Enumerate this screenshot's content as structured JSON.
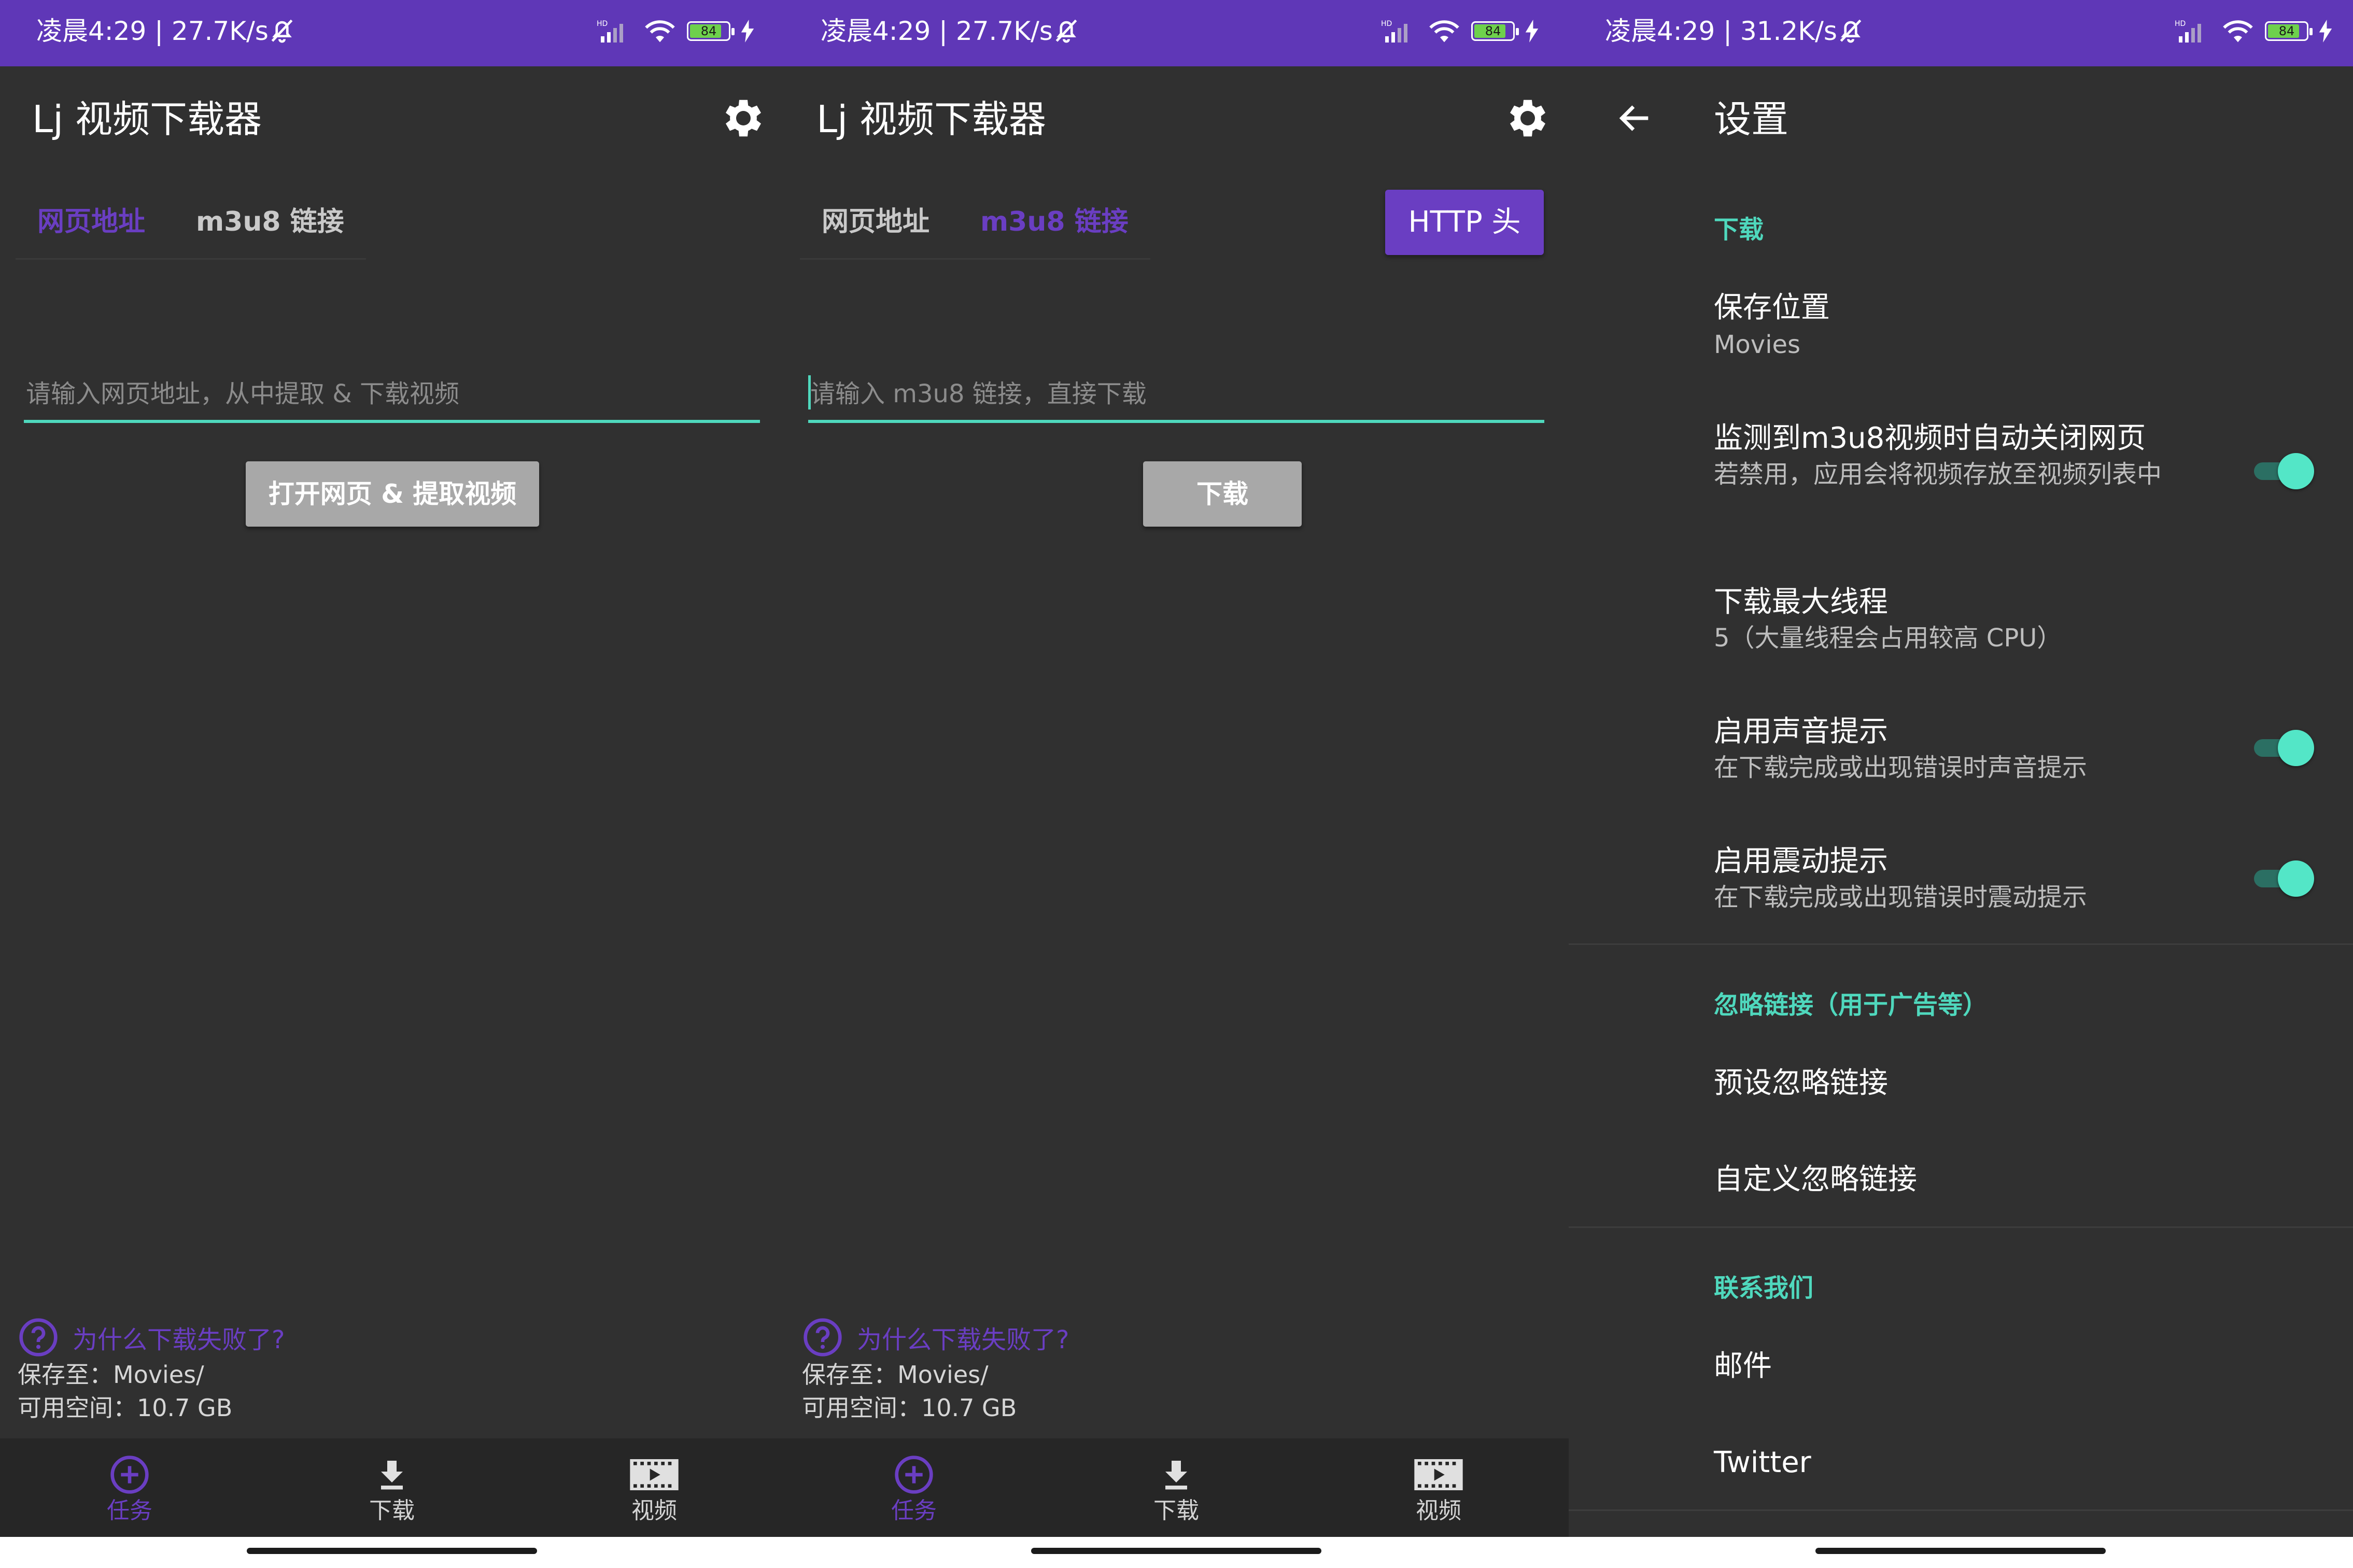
{
  "status_bars": [
    {
      "time_speed": "凌晨4:29 | 27.7K/s",
      "battery": "84"
    },
    {
      "time_speed": "凌晨4:29 | 27.7K/s",
      "battery": "84"
    },
    {
      "time_speed": "凌晨4:29 | 31.2K/s",
      "battery": "84"
    }
  ],
  "app": {
    "title": "Lj 视频下载器"
  },
  "tabs": {
    "webpage": "网页地址",
    "m3u8": "m3u8 链接"
  },
  "screen1": {
    "input_placeholder": "请输入网页地址，从中提取 & 下载视频",
    "button": "打开网页 & 提取视频"
  },
  "screen2": {
    "http_button": "HTTP 头",
    "input_placeholder": "请输入 m3u8 链接，直接下载",
    "button": "下载"
  },
  "footer": {
    "help": "为什么下载失败了?",
    "save_to": "保存至：Movies/",
    "free_space": "可用空间：10.7 GB"
  },
  "nav": {
    "tasks": "任务",
    "downloads": "下载",
    "videos": "视频"
  },
  "settings": {
    "title": "设置",
    "section_download": "下载",
    "save_location_title": "保存位置",
    "save_location_value": "Movies",
    "auto_close_title": "监测到m3u8视频时自动关闭网页",
    "auto_close_desc": "若禁用，应用会将视频存放至视频列表中",
    "max_threads_title": "下载最大线程",
    "max_threads_desc": "5（大量线程会占用较高 CPU）",
    "sound_title": "启用声音提示",
    "sound_desc": "在下载完成或出现错误时声音提示",
    "vibrate_title": "启用震动提示",
    "vibrate_desc": "在下载完成或出现错误时震动提示",
    "section_ignore": "忽略链接（用于广告等）",
    "preset_ignore": "预设忽略链接",
    "custom_ignore": "自定义忽略链接",
    "section_contact": "联系我们",
    "email": "邮件",
    "twitter": "Twitter"
  },
  "colors": {
    "status_bar": "#5f37b7",
    "accent_purple": "#6a3ec2",
    "accent_teal": "#4fd8bd",
    "background": "#303030"
  }
}
